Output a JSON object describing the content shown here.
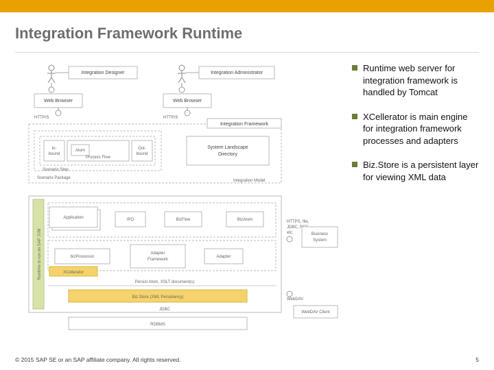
{
  "title": "Integration Framework Runtime",
  "bullets": [
    "Runtime web server for integration framework is handled by Tomcat",
    "XCellerator is main engine for integration framework processes and adapters",
    "Biz.Store is a persistent layer for viewing XML data"
  ],
  "diagram": {
    "roles": {
      "designer": "Integration Designer",
      "admin": "Integration Administrator"
    },
    "webBrowser": "Web Browser",
    "http": "HTTP/S",
    "integrationFramework": "Integration Framework",
    "integrationModel": "Integration Model",
    "scenarioPackage": "Scenario Package",
    "scenarioStep": "Scenario Step",
    "inbound": "In-\nbound",
    "atom": "Atom",
    "processFlow": "Process Flow",
    "outbound": "Out-\nbound",
    "sld": "System Landscape\nDirectory",
    "runtimeJvm": "Runtime to run on SAP JVM",
    "application": "Application",
    "ipo": "IPO",
    "bizFlow": "BizFlow",
    "bizAtom": "BizAtom",
    "bizProcessor": "bizProcessor",
    "adapterFramework": "Adapter\nFramework",
    "adapter": "Adapter",
    "xcellerator": "XCellerator",
    "persist": "Persist Atom, XSLT document(s)",
    "bizStore": "Biz.Store (XML Persistency)",
    "jdbc": "JDBC",
    "rdbms": "RDBMS",
    "webdav": "WebDAV",
    "webdavClient": "WebDAV Client",
    "httpsFile": "HTTPS, file,\nJDBC, RFC,\netc.",
    "businessSystem": "Business\nSystem"
  },
  "footer": {
    "copyright": "© 2015 SAP SE or an SAP affiliate company. All rights reserved.",
    "page": "5"
  }
}
